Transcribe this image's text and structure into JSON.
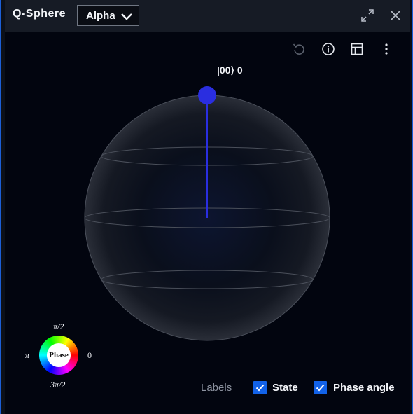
{
  "header": {
    "title": "Q-Sphere",
    "dropdown": {
      "selected": "Alpha"
    }
  },
  "toolbar": {
    "icons": [
      "undo-icon",
      "info-icon",
      "table-icon",
      "overflow-menu-icon"
    ]
  },
  "sphere": {
    "state_label": "|00⟩ 0",
    "state_color": "#2a2ee0",
    "state_probability": 1.0
  },
  "phase_wheel": {
    "center_label": "Phase",
    "top": "π/2",
    "left": "π",
    "right": "0",
    "bottom": "3π/2"
  },
  "labels": {
    "title": "Labels",
    "state": {
      "label": "State",
      "checked": true
    },
    "phase_angle": {
      "label": "Phase angle",
      "checked": true
    }
  },
  "colors": {
    "accent": "#1262e8",
    "background": "#02050f",
    "header": "#161b25"
  }
}
